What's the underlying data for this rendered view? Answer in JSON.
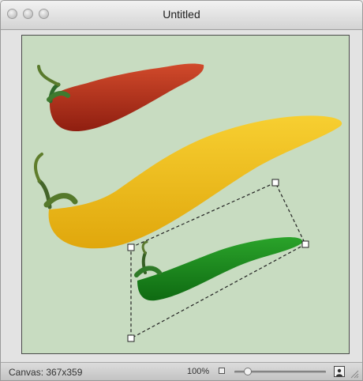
{
  "window": {
    "title": "Untitled"
  },
  "canvas": {
    "background": "#c8dcc1",
    "peppers": [
      {
        "name": "red-pepper",
        "color": "#b8341c"
      },
      {
        "name": "yellow-pepper",
        "color": "#f2be1a"
      },
      {
        "name": "green-pepper",
        "color": "#1c8f1e"
      }
    ],
    "selection": {
      "dashed": true
    }
  },
  "status": {
    "canvas_label": "Canvas: 367x359",
    "zoom": "100%",
    "slider_level": 0.15
  }
}
